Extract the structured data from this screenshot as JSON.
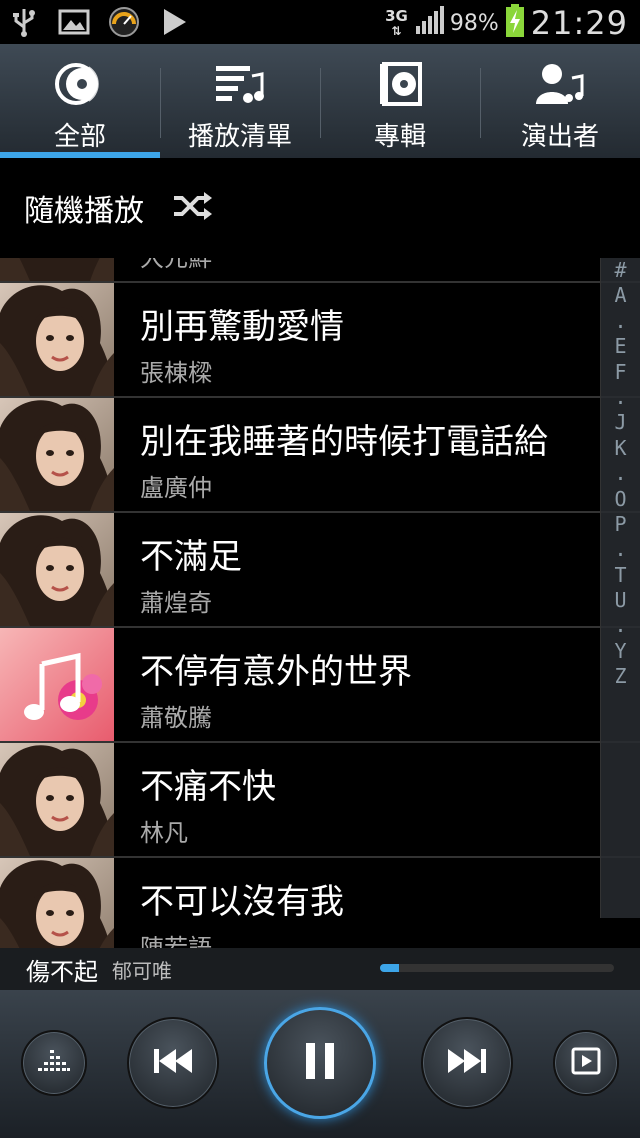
{
  "status_bar": {
    "network": "3G",
    "battery_percent": "98%",
    "time": "21:29",
    "icons": [
      "usb-icon",
      "image-icon",
      "speedometer-icon",
      "play-store-icon",
      "signal-icon",
      "battery-charging-icon"
    ]
  },
  "tabs": [
    {
      "label": "全部",
      "icon": "disc-icon",
      "active": true
    },
    {
      "label": "播放清單",
      "icon": "playlist-icon",
      "active": false
    },
    {
      "label": "專輯",
      "icon": "album-icon",
      "active": false
    },
    {
      "label": "演出者",
      "icon": "artist-icon",
      "active": false
    }
  ],
  "shuffle": {
    "label": "隨機播放",
    "icon": "shuffle-icon"
  },
  "songs": [
    {
      "title": "",
      "artist": "大元鮮",
      "thumb": "portrait"
    },
    {
      "title": "別再驚動愛情",
      "artist": "張棟樑",
      "thumb": "portrait"
    },
    {
      "title": "別在我睡著的時候打電話給",
      "artist": "盧廣仲",
      "thumb": "portrait"
    },
    {
      "title": "不滿足",
      "artist": "蕭煌奇",
      "thumb": "portrait"
    },
    {
      "title": "不停有意外的世界",
      "artist": "蕭敬騰",
      "thumb": "music-note"
    },
    {
      "title": "不痛不快",
      "artist": "林凡",
      "thumb": "portrait"
    },
    {
      "title": "不可以沒有我",
      "artist": "陳若語",
      "thumb": "portrait"
    }
  ],
  "index_letters": [
    "#",
    "A",
    ".",
    "E",
    "F",
    ".",
    "J",
    "K",
    ".",
    "O",
    "P",
    ".",
    "T",
    "U",
    ".",
    "Y",
    "Z"
  ],
  "now_playing": {
    "title": "傷不起",
    "artist": "郁可唯",
    "progress": 0.08
  },
  "controls": {
    "equalizer": "equalizer-icon",
    "previous": "previous-icon",
    "pause": "pause-icon",
    "next": "next-icon",
    "now_playing_screen": "now-playing-screen-icon"
  },
  "colors": {
    "accent": "#3da5e8",
    "tab_bg": "#2e363e",
    "list_bg": "#000000"
  }
}
